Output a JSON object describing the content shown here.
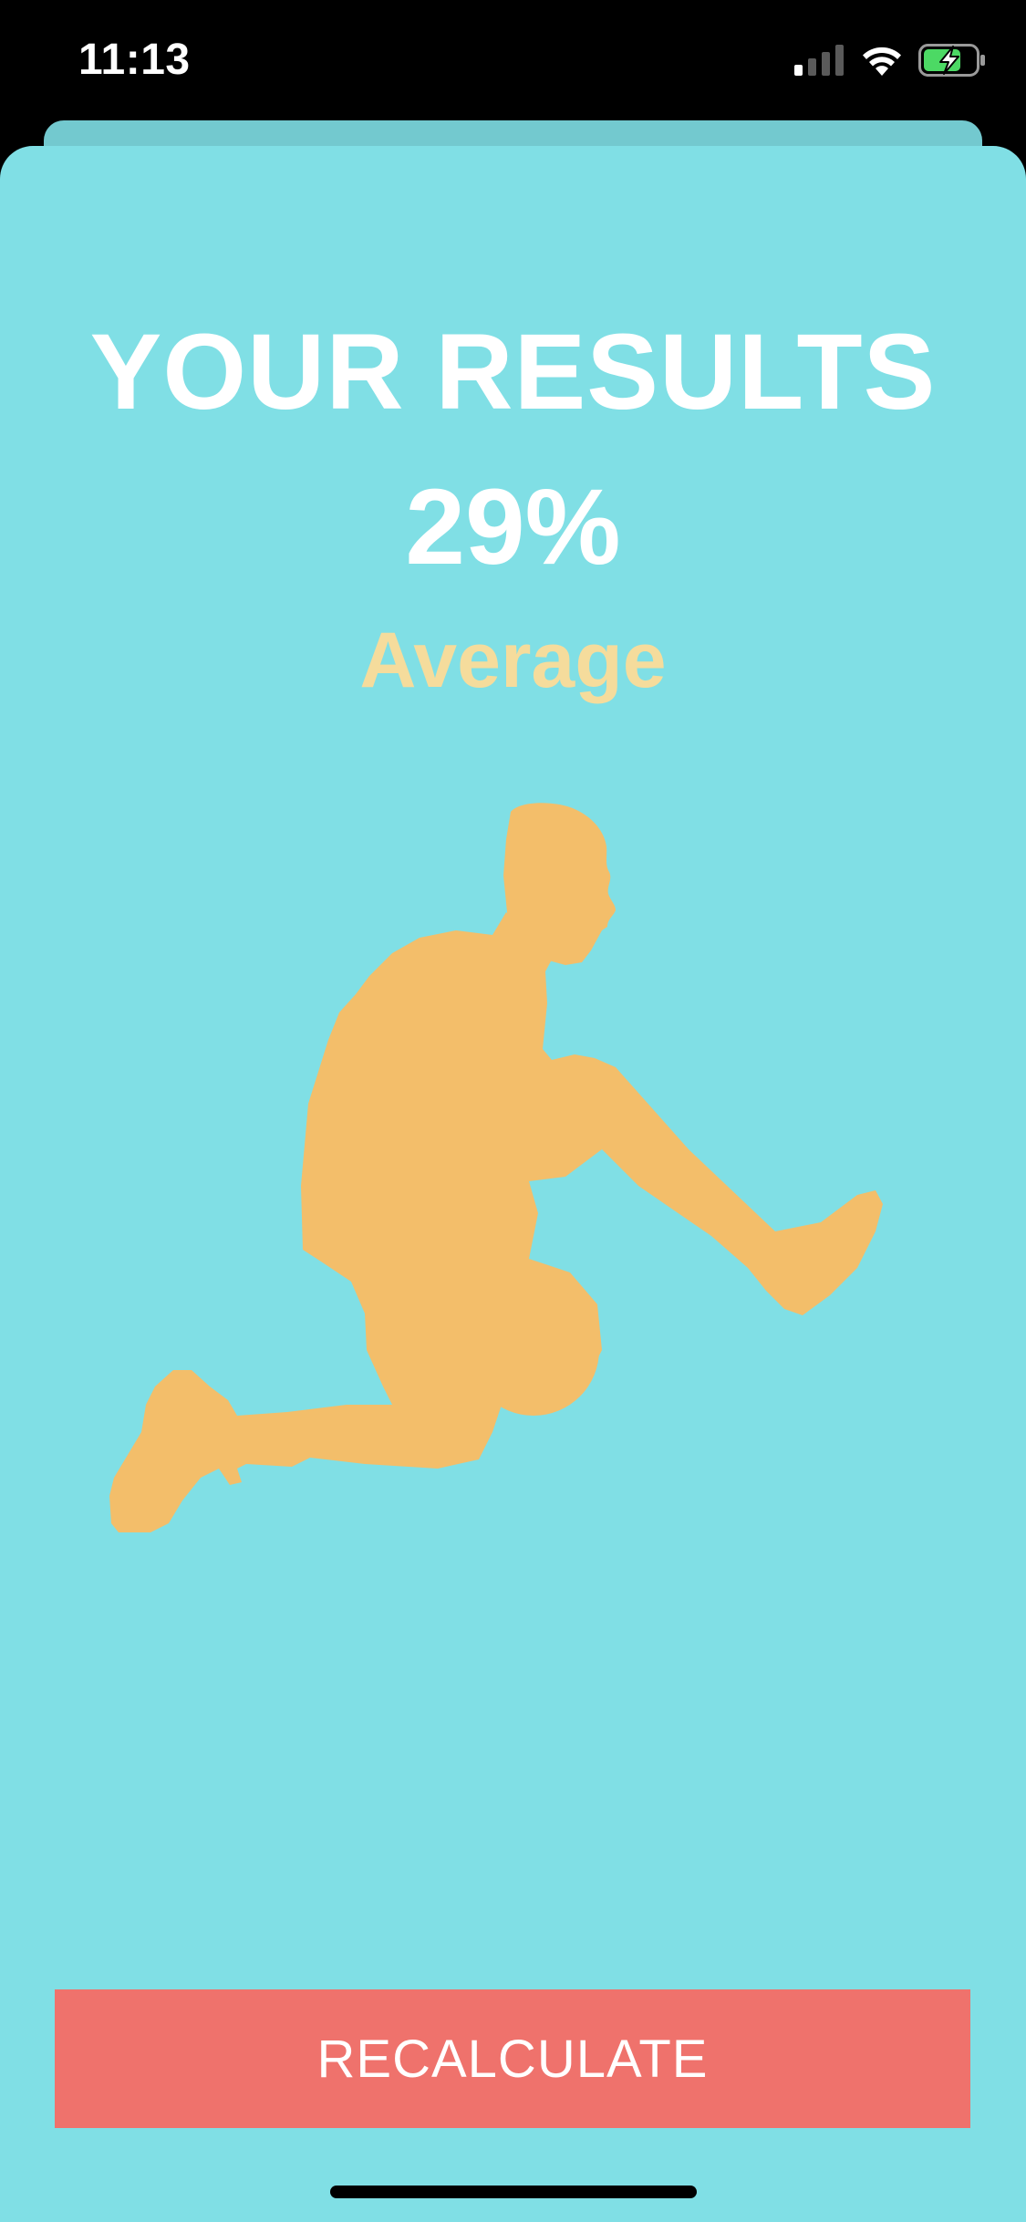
{
  "status_bar": {
    "time": "11:13",
    "icons": [
      "cellular-signal-icon",
      "wifi-icon",
      "battery-charging-icon"
    ],
    "battery_color": "#4cd964"
  },
  "results": {
    "title": "YOUR RESULTS",
    "percent": "29%",
    "rating": "Average",
    "illustration": "basketball-player-dribbling-silhouette"
  },
  "actions": {
    "recalculate_label": "RECALCULATE"
  },
  "colors": {
    "background": "#80dfe5",
    "sheet_back": "#73c9cf",
    "title_text": "#ffffff",
    "rating_text": "#f5dc9c",
    "silhouette": "#f3be6a",
    "button": "#ef726c"
  }
}
